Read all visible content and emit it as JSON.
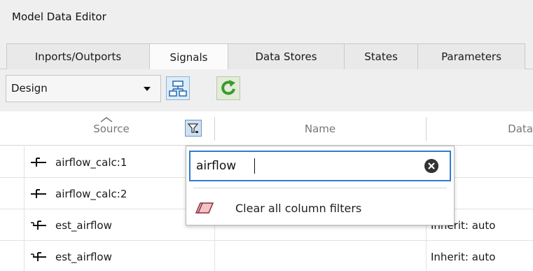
{
  "window": {
    "title": "Model Data Editor"
  },
  "tabs": [
    {
      "label": "Inports/Outports"
    },
    {
      "label": "Signals"
    },
    {
      "label": "Data Stores"
    },
    {
      "label": "States"
    },
    {
      "label": "Parameters"
    }
  ],
  "toolbar": {
    "view_select_value": "Design",
    "icons": [
      "hierarchy-icon",
      "refresh-icon"
    ]
  },
  "table": {
    "columns": [
      {
        "label": "Source"
      },
      {
        "label": "Name"
      },
      {
        "label": "Data"
      }
    ],
    "rows": [
      {
        "source": "airflow_calc:1",
        "name": "",
        "data": ""
      },
      {
        "source": "airflow_calc:2",
        "name": "",
        "data": ""
      },
      {
        "source": "est_airflow",
        "name": "",
        "data": "Inherit: auto"
      },
      {
        "source": "est_airflow",
        "name": "",
        "data": "Inherit: auto"
      }
    ]
  },
  "filter_popup": {
    "search_value": "airflow",
    "clear_label": "Clear all column filters"
  },
  "colors": {
    "accent": "#2e7dd2",
    "tab_bg": "#efefef"
  }
}
